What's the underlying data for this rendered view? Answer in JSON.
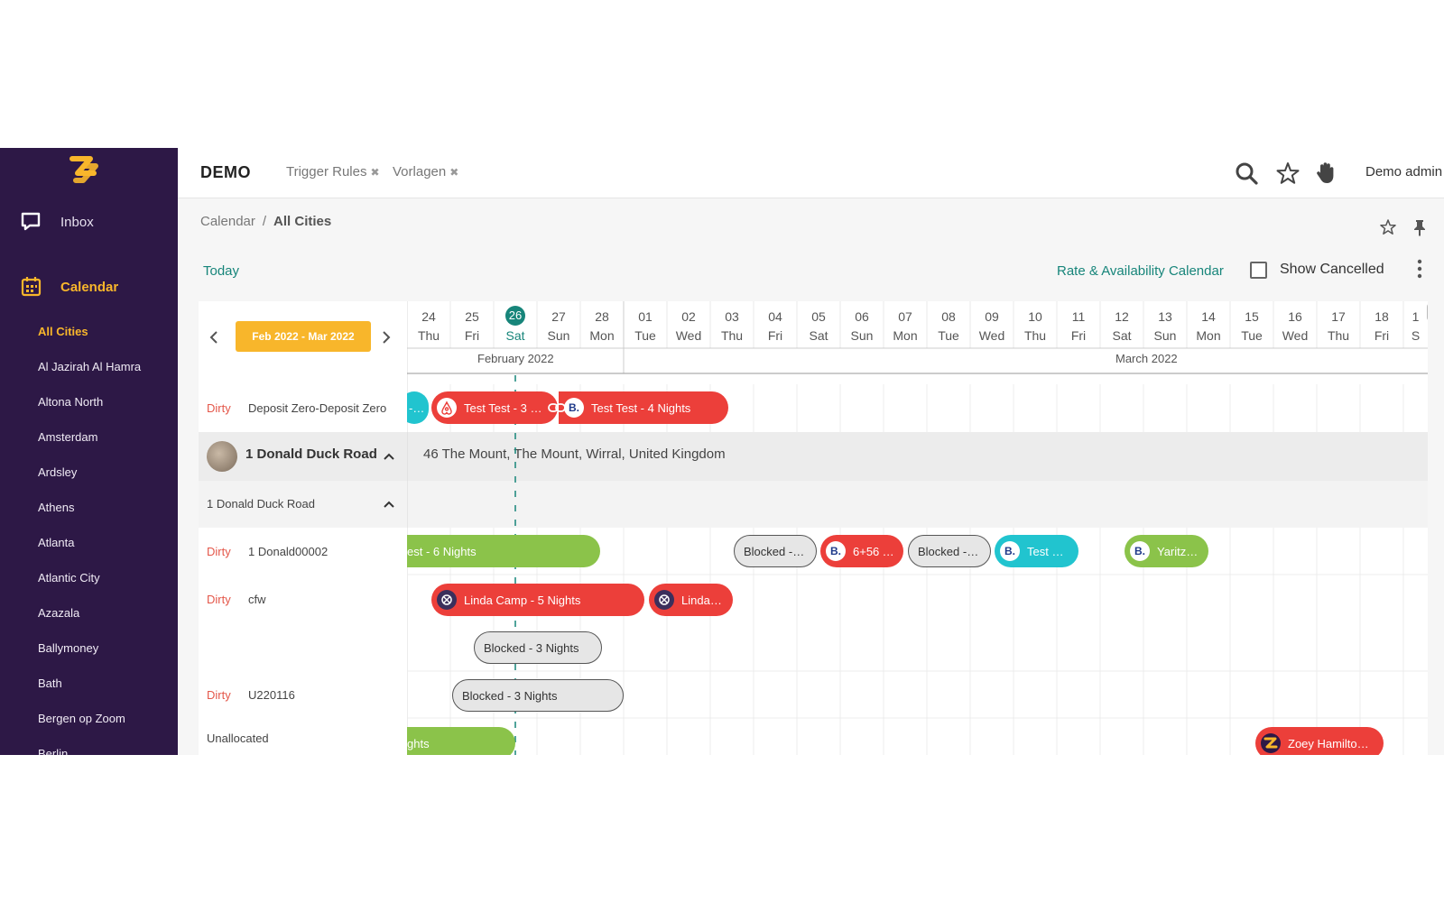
{
  "sidebar": {
    "inbox_label": "Inbox",
    "calendar_label": "Calendar",
    "cities": [
      "All Cities",
      "Al Jazirah Al Hamra",
      "Altona North",
      "Amsterdam",
      "Ardsley",
      "Athens",
      "Atlanta",
      "Atlantic City",
      "Azazala",
      "Ballymoney",
      "Bath",
      "Bergen op Zoom",
      "Berlin"
    ]
  },
  "topbar": {
    "brand": "DEMO",
    "tabs": [
      {
        "label": "Trigger Rules"
      },
      {
        "label": "Vorlagen"
      }
    ],
    "close_glyph": "✖",
    "user": "Demo admin"
  },
  "breadcrumb": {
    "parent": "Calendar",
    "separator": "/",
    "current": "All Cities"
  },
  "toolbar": {
    "today": "Today",
    "rate_link": "Rate & Availability Calendar",
    "show_cancelled": "Show Cancelled"
  },
  "calendar": {
    "range_label": "Feb 2022 - Mar 2022",
    "days": [
      {
        "num": "24",
        "name": "Thu"
      },
      {
        "num": "25",
        "name": "Fri"
      },
      {
        "num": "26",
        "name": "Sat",
        "today": true
      },
      {
        "num": "27",
        "name": "Sun"
      },
      {
        "num": "28",
        "name": "Mon"
      },
      {
        "num": "01",
        "name": "Tue"
      },
      {
        "num": "02",
        "name": "Wed"
      },
      {
        "num": "03",
        "name": "Thu"
      },
      {
        "num": "04",
        "name": "Fri"
      },
      {
        "num": "05",
        "name": "Sat"
      },
      {
        "num": "06",
        "name": "Sun"
      },
      {
        "num": "07",
        "name": "Mon"
      },
      {
        "num": "08",
        "name": "Tue"
      },
      {
        "num": "09",
        "name": "Wed"
      },
      {
        "num": "10",
        "name": "Thu"
      },
      {
        "num": "11",
        "name": "Fri"
      },
      {
        "num": "12",
        "name": "Sat"
      },
      {
        "num": "13",
        "name": "Sun"
      },
      {
        "num": "14",
        "name": "Mon"
      },
      {
        "num": "15",
        "name": "Tue"
      },
      {
        "num": "16",
        "name": "Wed"
      },
      {
        "num": "17",
        "name": "Thu"
      },
      {
        "num": "18",
        "name": "Fri"
      },
      {
        "num": "1",
        "name": "S"
      }
    ],
    "months": [
      "February 2022",
      "March 2022"
    ],
    "rows": {
      "deposit": {
        "status": "Dirty",
        "name": "Deposit Zero-Deposit Zero"
      },
      "group": {
        "title": "1 Donald Duck Road",
        "address": "46 The Mount, The Mount, Wirral, United Kingdom"
      },
      "sub": {
        "title": "1 Donald Duck Road"
      },
      "unit1": {
        "status": "Dirty",
        "name": "1 Donald00002"
      },
      "unit2": {
        "status": "Dirty",
        "name": "cfw"
      },
      "unit3": {
        "status": "Dirty",
        "name": "U220116"
      },
      "unalloc": {
        "name": "Unallocated"
      }
    },
    "bookings": {
      "b1": "-...",
      "b2": "Test Test - 3 Ni...",
      "b3": "Test Test - 4 Nights",
      "b4": "est - 6 Nights",
      "b5": "Blocked - 2 ...",
      "b6": "6+56 T...",
      "b7": "Blocked - 2 ...",
      "b8": "Test Du...",
      "b9": "Yaritza ...",
      "b10": "Linda Camp - 5 Nights",
      "b11": "Linda C...",
      "b12": "Blocked - 3 Nights",
      "b13": "Blocked - 3 Nights",
      "b14": "ghts",
      "b15": "Zoey Hamilton -..."
    },
    "channel_glyph_booking": "B.",
    "channel_glyph_airbnb": "A"
  },
  "colors": {
    "sidebar_bg": "#2d1846",
    "accent_orange": "#f8b62b",
    "accent_teal": "#17857a",
    "booking_red": "#ec3f3a",
    "booking_teal": "#21c4cf",
    "booking_green": "#8bc34a",
    "dirty": "#e4574a"
  }
}
